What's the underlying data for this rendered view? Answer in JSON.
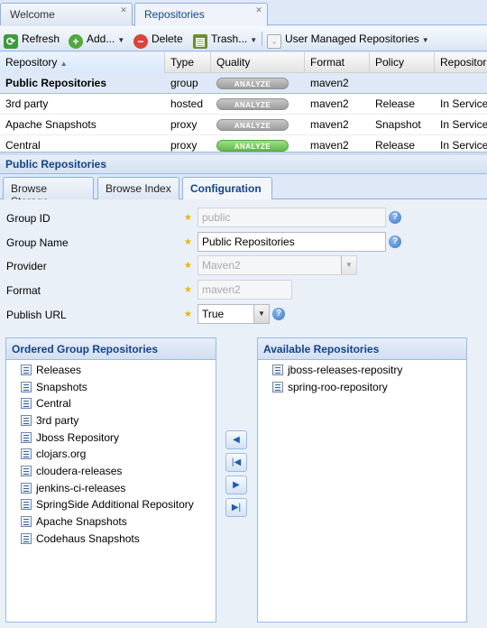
{
  "tabs": [
    {
      "label": "Welcome",
      "active": false
    },
    {
      "label": "Repositories",
      "active": true
    }
  ],
  "toolbar": {
    "refresh": "Refresh",
    "add": "Add...",
    "delete": "Delete",
    "trash": "Trash...",
    "user_managed": "User Managed Repositories"
  },
  "grid": {
    "columns": [
      "Repository",
      "Type",
      "Quality",
      "Format",
      "Policy",
      "Repositor"
    ],
    "analyze_label": "ANALYZE",
    "rows": [
      {
        "name": "Public Repositories",
        "type": "group",
        "format": "maven2",
        "policy": "",
        "status": "",
        "selected": true
      },
      {
        "name": "3rd party",
        "type": "hosted",
        "format": "maven2",
        "policy": "Release",
        "status": "In Service"
      },
      {
        "name": "Apache Snapshots",
        "type": "proxy",
        "format": "maven2",
        "policy": "Snapshot",
        "status": "In Service"
      },
      {
        "name": "Central",
        "type": "proxy",
        "format": "maven2",
        "policy": "Release",
        "status": "In Service"
      }
    ]
  },
  "panel": {
    "title": "Public Repositories",
    "subtabs": [
      "Browse Storage",
      "Browse Index",
      "Configuration"
    ],
    "active_subtab": "Configuration"
  },
  "form": {
    "group_id": {
      "label": "Group ID",
      "value": "public"
    },
    "group_name": {
      "label": "Group Name",
      "value": "Public Repositories"
    },
    "provider": {
      "label": "Provider",
      "value": "Maven2"
    },
    "format": {
      "label": "Format",
      "value": "maven2"
    },
    "publish_url": {
      "label": "Publish URL",
      "value": "True"
    }
  },
  "ordered": {
    "title": "Ordered Group Repositories",
    "items": [
      "Releases",
      "Snapshots",
      "Central",
      "3rd party",
      "Jboss Repository",
      "clojars.org",
      "cloudera-releases",
      "jenkins-ci-releases",
      "SpringSide Additional Repository",
      "Apache Snapshots",
      "Codehaus Snapshots"
    ]
  },
  "available": {
    "title": "Available Repositories",
    "items": [
      "jboss-releases-repositry",
      "spring-roo-repository"
    ]
  },
  "colors": {
    "accent": "#15428b",
    "border": "#99bbe8",
    "star": "#e8b400"
  }
}
